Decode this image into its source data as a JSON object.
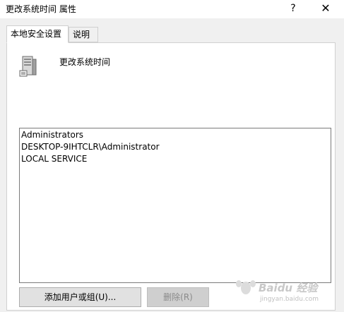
{
  "window": {
    "title": "更改系统时间 属性",
    "help_label": "?",
    "close_label": "✕"
  },
  "tabs": [
    {
      "label": "本地安全设置",
      "active": true
    },
    {
      "label": "说明",
      "active": false
    }
  ],
  "policy": {
    "icon": "server-policy-icon",
    "name": "更改系统时间"
  },
  "principals": [
    "Administrators",
    "DESKTOP-9IHTCLR\\Administrator",
    "LOCAL SERVICE"
  ],
  "buttons": {
    "add_label": "添加用户或组(U)...",
    "remove_label": "删除(R)"
  },
  "watermark": {
    "text": "Baidu 经验",
    "subtext": "jingyan.baidu.com"
  }
}
